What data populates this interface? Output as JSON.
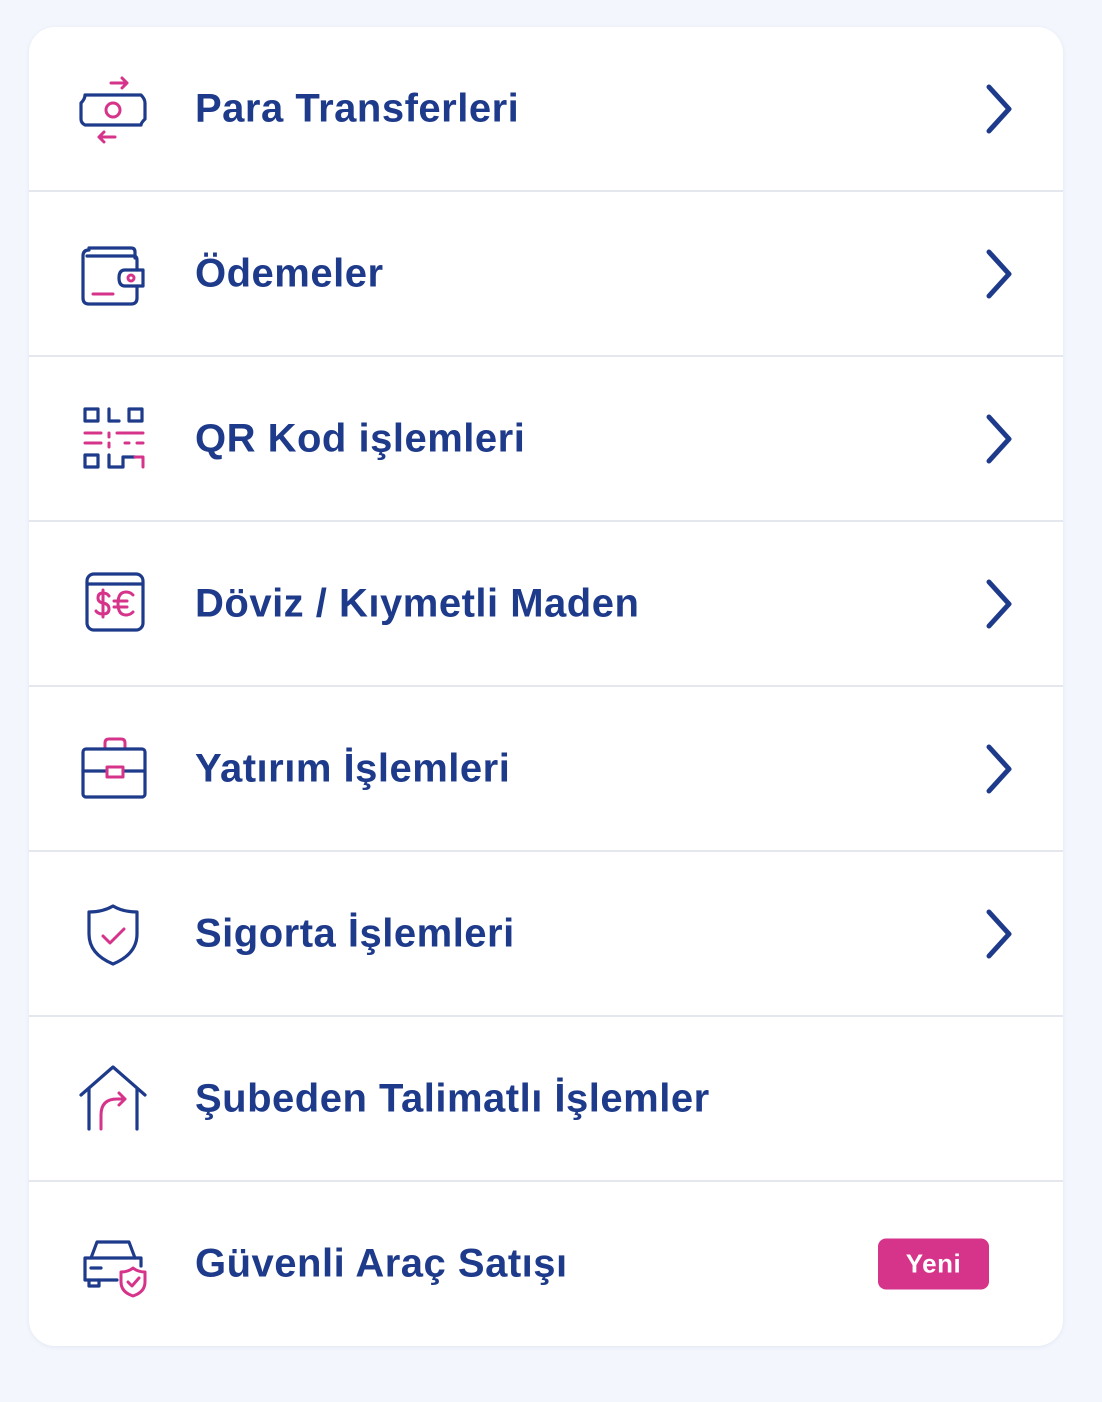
{
  "colors": {
    "primary": "#1e3a8a",
    "accent": "#d6338a",
    "background": "#f3f6fd",
    "divider": "#e4e7ee"
  },
  "menu": {
    "items": [
      {
        "label": "Para Transferleri",
        "icon": "money-transfer-icon",
        "has_chevron": true
      },
      {
        "label": "Ödemeler",
        "icon": "wallet-icon",
        "has_chevron": true
      },
      {
        "label": "QR Kod işlemleri",
        "icon": "qr-code-icon",
        "has_chevron": true
      },
      {
        "label": "Döviz / Kıymetli Maden",
        "icon": "currency-exchange-icon",
        "has_chevron": true
      },
      {
        "label": "Yatırım İşlemleri",
        "icon": "briefcase-icon",
        "has_chevron": true
      },
      {
        "label": "Sigorta İşlemleri",
        "icon": "shield-check-icon",
        "has_chevron": true
      },
      {
        "label": "Şubeden Talimatlı İşlemler",
        "icon": "branch-redirect-icon",
        "has_chevron": false
      },
      {
        "label": "Güvenli Araç Satışı",
        "icon": "car-shield-icon",
        "has_chevron": false,
        "badge": "Yeni"
      }
    ]
  }
}
